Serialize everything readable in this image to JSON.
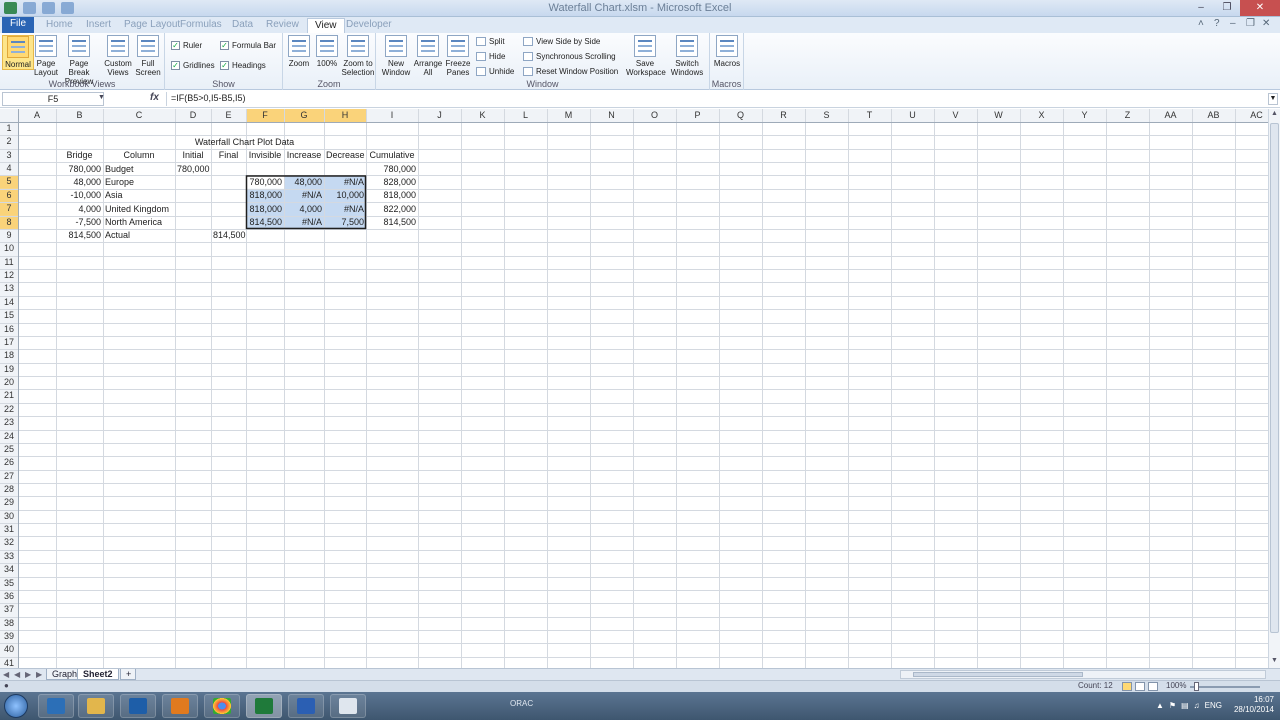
{
  "window": {
    "title": "Waterfall Chart.xlsm - Microsoft Excel"
  },
  "ribbon": {
    "tabs": [
      {
        "label": "File",
        "active": false
      },
      {
        "label": "Home",
        "active": false
      },
      {
        "label": "Insert",
        "active": false
      },
      {
        "label": "Page Layout",
        "active": false
      },
      {
        "label": "Formulas",
        "active": false
      },
      {
        "label": "Data",
        "active": false
      },
      {
        "label": "Review",
        "active": false
      },
      {
        "label": "View",
        "active": true
      },
      {
        "label": "Developer",
        "active": false
      }
    ],
    "groups": {
      "workbook_views": {
        "label": "Workbook Views",
        "buttons": [
          "Normal",
          "Page Layout",
          "Page Break Preview",
          "Custom Views",
          "Full Screen"
        ]
      },
      "show": {
        "label": "Show",
        "checks": [
          {
            "label": "Ruler",
            "checked": true
          },
          {
            "label": "Formula Bar",
            "checked": true
          },
          {
            "label": "Gridlines",
            "checked": true
          },
          {
            "label": "Headings",
            "checked": true
          }
        ]
      },
      "zoom": {
        "label": "Zoom",
        "buttons": [
          "Zoom",
          "100%",
          "Zoom to Selection"
        ]
      },
      "window": {
        "label": "Window",
        "buttons": [
          "New Window",
          "Arrange All",
          "Freeze Panes"
        ],
        "small": [
          "Split",
          "Hide",
          "Unhide"
        ],
        "side": [
          "View Side by Side",
          "Synchronous Scrolling",
          "Reset Window Position"
        ],
        "big2": [
          "Save Workspace",
          "Switch Windows"
        ]
      },
      "macros": {
        "label": "Macros",
        "buttons": [
          "Macros"
        ]
      }
    }
  },
  "formula_bar": {
    "name_box": "F5",
    "formula": "=IF(B5>0,I5-B5,I5)"
  },
  "sheet": {
    "columns": [
      "A",
      "B",
      "C",
      "D",
      "E",
      "F",
      "G",
      "H",
      "I",
      "J",
      "K",
      "L",
      "M",
      "N",
      "O",
      "P",
      "Q",
      "R",
      "S",
      "T",
      "U",
      "V",
      "W",
      "X",
      "Y",
      "Z",
      "AA",
      "AB",
      "AC"
    ],
    "selected_columns": [
      "F",
      "G",
      "H"
    ],
    "selected_rows": [
      5,
      6,
      7,
      8
    ],
    "row_count": 41,
    "title": "Waterfall Chart Plot Data",
    "headers": {
      "B": "Bridge",
      "C": "Column",
      "D": "Initial",
      "E": "Final",
      "F": "Invisible",
      "G": "Increase",
      "H": "Decrease",
      "I": "Cumulative"
    },
    "rows": [
      {
        "row": 4,
        "B": "780,000",
        "C": "Budget",
        "D": "780,000",
        "E": "",
        "F": "",
        "G": "",
        "H": "",
        "I": "780,000"
      },
      {
        "row": 5,
        "B": "48,000",
        "C": "Europe",
        "D": "",
        "E": "",
        "F": "780,000",
        "G": "48,000",
        "H": "#N/A",
        "I": "828,000"
      },
      {
        "row": 6,
        "B": "-10,000",
        "C": "Asia",
        "D": "",
        "E": "",
        "F": "818,000",
        "G": "#N/A",
        "H": "10,000",
        "I": "818,000"
      },
      {
        "row": 7,
        "B": "4,000",
        "C": "United Kingdom",
        "D": "",
        "E": "",
        "F": "818,000",
        "G": "4,000",
        "H": "#N/A",
        "I": "822,000"
      },
      {
        "row": 8,
        "B": "-7,500",
        "C": "North America",
        "D": "",
        "E": "",
        "F": "814,500",
        "G": "#N/A",
        "H": "7,500",
        "I": "814,500"
      },
      {
        "row": 9,
        "B": "814,500",
        "C": "Actual",
        "D": "",
        "E": "814,500",
        "F": "",
        "G": "",
        "H": "",
        "I": ""
      }
    ]
  },
  "sheet_tabs": [
    {
      "label": "Graph",
      "active": false
    },
    {
      "label": "Sheet2",
      "active": true
    }
  ],
  "status_bar": {
    "count": "Count: 12",
    "zoom": "100%"
  },
  "taskbar": {
    "label": "ORAC",
    "time": "16:07",
    "date": "28/10/2014",
    "lang": "ENG"
  }
}
